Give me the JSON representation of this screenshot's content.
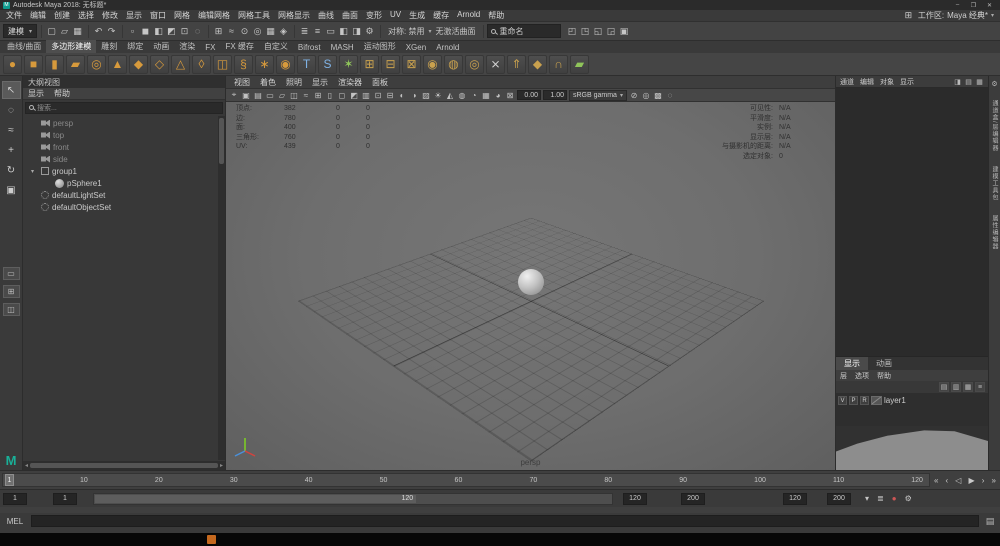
{
  "glyphs": {
    "app_initial": "M",
    "minimize": "–",
    "maximize": "❐",
    "close": "✕",
    "caret": "▾",
    "workspace_icon": "⊞",
    "script_editor_icon": "▤",
    "logo": "M"
  },
  "titlebar": {
    "title": "Autodesk Maya 2018: 无标题*"
  },
  "menubar": {
    "items": [
      "文件",
      "编辑",
      "创建",
      "选择",
      "修改",
      "显示",
      "窗口",
      "网格",
      "编辑网格",
      "网格工具",
      "网格显示",
      "曲线",
      "曲面",
      "变形",
      "UV",
      "生成",
      "缓存",
      "Arnold",
      "帮助"
    ],
    "workspace_label": "工作区:",
    "workspace_value": "Maya 经典*"
  },
  "statusline": {
    "menuset": "建模",
    "symmetry": "对称: 禁用",
    "live_surface": "无激活曲面",
    "name_field_text": "重命名",
    "file_ops": [
      {
        "g": "▢",
        "n": "new-scene-icon"
      },
      {
        "g": "▱",
        "n": "open-scene-icon"
      },
      {
        "g": "▦",
        "n": "save-scene-icon"
      }
    ],
    "undo_redo": [
      {
        "g": "↶",
        "n": "undo-icon"
      },
      {
        "g": "↷",
        "n": "redo-icon"
      }
    ],
    "selection": [
      {
        "g": "▫",
        "n": "select-hierarchy-icon"
      },
      {
        "g": "◼",
        "n": "select-object-icon"
      },
      {
        "g": "◧",
        "n": "select-component-icon"
      },
      {
        "g": "◩",
        "n": "selection-mask-icon"
      },
      {
        "g": "⊡",
        "n": "lock-selection-icon"
      },
      {
        "g": "◌",
        "n": "highlight-selection-icon"
      }
    ],
    "snapping": [
      {
        "g": "⊞",
        "n": "snap-to-grids-icon"
      },
      {
        "g": "≈",
        "n": "snap-to-curves-icon"
      },
      {
        "g": "⊙",
        "n": "snap-to-points-icon"
      },
      {
        "g": "◎",
        "n": "snap-to-projected-center-icon"
      },
      {
        "g": "▦",
        "n": "snap-to-view-planes-icon"
      },
      {
        "g": "◈",
        "n": "make-live-icon"
      }
    ],
    "history_render": [
      {
        "g": "≣",
        "n": "input-operations-icon"
      },
      {
        "g": "≡",
        "n": "construction-history-icon"
      },
      {
        "g": "▭",
        "n": "render-view-icon"
      },
      {
        "g": "◧",
        "n": "render-current-frame-icon"
      },
      {
        "g": "◨",
        "n": "ipr-render-icon"
      },
      {
        "g": "⚙",
        "n": "render-settings-icon"
      }
    ],
    "sidebar_toggles": [
      {
        "g": "◰",
        "n": "attribute-editor-toggle-icon"
      },
      {
        "g": "◳",
        "n": "tool-settings-toggle-icon"
      },
      {
        "g": "◱",
        "n": "channel-box-toggle-icon"
      },
      {
        "g": "◲",
        "n": "modeling-toolkit-toggle-icon"
      },
      {
        "g": "▣",
        "n": "humanik-toggle-ic icon"
      }
    ]
  },
  "shelf": {
    "tabs": [
      {
        "label": "曲线/曲面"
      },
      {
        "label": "多边形建模",
        "cls": "active"
      },
      {
        "label": "雕刻"
      },
      {
        "label": "绑定"
      },
      {
        "label": "动画"
      },
      {
        "label": "渲染"
      },
      {
        "label": "FX"
      },
      {
        "label": "FX 缓存"
      },
      {
        "label": "自定义"
      },
      {
        "label": "Bifrost"
      },
      {
        "label": "MASH"
      },
      {
        "label": "运动图形"
      },
      {
        "label": "XGen"
      },
      {
        "label": "Arnold"
      }
    ],
    "icons": [
      {
        "g": "●",
        "c": "#d79a3c",
        "n": "poly-sphere-icon"
      },
      {
        "g": "■",
        "c": "#d79a3c",
        "n": "poly-cube-icon"
      },
      {
        "g": "▮",
        "c": "#d79a3c",
        "n": "poly-cylinder-icon"
      },
      {
        "g": "▰",
        "c": "#d79a3c",
        "n": "poly-plane-icon"
      },
      {
        "g": "◎",
        "c": "#d79a3c",
        "n": "poly-torus-icon"
      },
      {
        "g": "▲",
        "c": "#d79a3c",
        "n": "poly-cone-icon"
      },
      {
        "g": "◆",
        "c": "#d79a3c",
        "n": "poly-disc-icon"
      },
      {
        "g": "◇",
        "c": "#d79a3c",
        "n": "poly-platonic-icon"
      },
      {
        "g": "△",
        "c": "#d79a3c",
        "n": "poly-pyramid-icon"
      },
      {
        "g": "◊",
        "c": "#d79a3c",
        "n": "poly-prism-icon"
      },
      {
        "g": "◫",
        "c": "#d79a3c",
        "n": "poly-pipe-icon"
      },
      {
        "g": "§",
        "c": "#d79a3c",
        "n": "poly-helix-icon"
      },
      {
        "g": "∗",
        "c": "#d79a3c",
        "n": "poly-gear-icon"
      },
      {
        "g": "◉",
        "c": "#d79a3c",
        "n": "poly-soccer-icon"
      },
      {
        "g": "T",
        "c": "#7fb2e5",
        "n": "poly-type-icon"
      },
      {
        "g": "S",
        "c": "#7fb2e5",
        "n": "svg-tool-icon"
      },
      {
        "g": "✶",
        "c": "#8fc45a",
        "n": "super-shape-icon"
      },
      {
        "g": "⊞",
        "c": "#c9a14e",
        "n": "combine-icon"
      },
      {
        "g": "⊟",
        "c": "#c9a14e",
        "n": "separate-icon"
      },
      {
        "g": "⊠",
        "c": "#c9a14e",
        "n": "extract-icon"
      },
      {
        "g": "◉",
        "c": "#c9a14e",
        "n": "boolean-icon"
      },
      {
        "g": "◍",
        "c": "#c9a14e",
        "n": "smooth-icon"
      },
      {
        "g": "◎",
        "c": "#c9a14e",
        "n": "reduce-icon"
      },
      {
        "g": "⨯",
        "c": "#d4d4d4",
        "n": "multi-cut-icon"
      },
      {
        "g": "⇑",
        "c": "#c9a14e",
        "n": "extrude-icon"
      },
      {
        "g": "◆",
        "c": "#c9a14e",
        "n": "bevel-icon"
      },
      {
        "g": "∩",
        "c": "#c9a14e",
        "n": "bridge-icon"
      },
      {
        "g": "▰",
        "c": "#8fc45a",
        "n": "quad-draw-icon"
      }
    ]
  },
  "toolbox": {
    "tools": [
      {
        "g": "↖",
        "n": "select-tool-icon",
        "cls": "active"
      },
      {
        "g": "◌",
        "n": "lasso-tool-icon"
      },
      {
        "g": "≈",
        "n": "paint-select-tool-icon"
      },
      {
        "g": "+",
        "n": "move-tool-icon"
      },
      {
        "g": "↻",
        "n": "rotate-tool-icon"
      },
      {
        "g": "▣",
        "n": "scale-tool-icon"
      }
    ],
    "layouts": [
      {
        "g": "▭",
        "n": "single-pane-layout-button"
      },
      {
        "g": "⊞",
        "n": "four-pane-layout-button"
      },
      {
        "g": "◫",
        "n": "two-pane-layout-button"
      }
    ]
  },
  "outliner": {
    "title": "大纲视图",
    "menus": [
      "显示",
      "帮助"
    ],
    "search_placeholder": "搜索...",
    "items": [
      {
        "label": "persp",
        "icon": "cam",
        "cls": "dim",
        "exp": ""
      },
      {
        "label": "top",
        "icon": "cam",
        "cls": "dim",
        "exp": ""
      },
      {
        "label": "front",
        "icon": "cam",
        "cls": "dim",
        "exp": ""
      },
      {
        "label": "side",
        "icon": "cam",
        "cls": "dim",
        "exp": ""
      },
      {
        "label": "group1",
        "icon": "grp",
        "exp": "▾"
      },
      {
        "label": "pSphere1",
        "icon": "sph",
        "cls": "child",
        "exp": ""
      },
      {
        "label": "defaultLightSet",
        "icon": "set",
        "exp": ""
      },
      {
        "label": "defaultObjectSet",
        "icon": "set",
        "exp": ""
      }
    ]
  },
  "viewport": {
    "menus": [
      "视图",
      "着色",
      "照明",
      "显示",
      "渲染器",
      "面板"
    ],
    "toolbar_icons": [
      {
        "g": "⌖",
        "n": "select-camera-icon"
      },
      {
        "g": "▣",
        "n": "lock-camera-icon"
      },
      {
        "g": "▤",
        "n": "camera-attributes-icon"
      },
      {
        "g": "▭",
        "n": "bookmarks-icon"
      },
      {
        "g": "▱",
        "n": "image-plane-icon"
      },
      {
        "g": "◫",
        "n": "2d-pan-zoom-icon"
      },
      {
        "g": "≈",
        "n": "grease-pencil-icon"
      },
      {
        "g": "⊞",
        "n": "grid-icon"
      },
      {
        "g": "▯",
        "n": "film-gate-icon"
      },
      {
        "g": "◻",
        "n": "resolution-gate-icon"
      },
      {
        "g": "◩",
        "n": "gate-mask-icon"
      },
      {
        "g": "▥",
        "n": "field-chart-icon"
      },
      {
        "g": "⊡",
        "n": "safe-action-icon"
      },
      {
        "g": "⊟",
        "n": "safe-title-icon"
      },
      {
        "g": "◐",
        "n": "wireframe-icon"
      },
      {
        "g": "◑",
        "n": "smooth-shade-icon"
      },
      {
        "g": "▨",
        "n": "textured-icon"
      },
      {
        "g": "☀",
        "n": "lighting-icon"
      },
      {
        "g": "◭",
        "n": "shadows-icon"
      },
      {
        "g": "◍",
        "n": "ssao-icon"
      },
      {
        "g": "◔",
        "n": "motion-blur-icon"
      },
      {
        "g": "▦",
        "n": "multisample-icon"
      },
      {
        "g": "◕",
        "n": "depth-of-field-icon"
      },
      {
        "g": "⊠",
        "n": "isolate-select-icon"
      }
    ],
    "exposure": "0.00",
    "gamma": "1.00",
    "view_transform": "sRGB gamma",
    "toolbar_icons_right": [
      {
        "g": "⊘",
        "n": "xray-icon"
      },
      {
        "g": "◎",
        "n": "exposure-toggle-icon"
      },
      {
        "g": "▩",
        "n": "gamma-toggle-icon"
      },
      {
        "g": "◌",
        "n": "view-transform-icon"
      }
    ],
    "hud_left": [
      [
        "顶点:",
        "382",
        "0",
        "0"
      ],
      [
        "边:",
        "780",
        "0",
        "0"
      ],
      [
        "面:",
        "400",
        "0",
        "0"
      ],
      [
        "三角形:",
        "760",
        "0",
        "0"
      ],
      [
        "UV:",
        "439",
        "0",
        "0"
      ]
    ],
    "hud_right": [
      [
        "可见性:",
        "N/A"
      ],
      [
        "平滑度:",
        "N/A"
      ],
      [
        "实例:",
        "N/A"
      ],
      [
        "显示层:",
        "N/A"
      ],
      [
        "与摄影机的距离:",
        "N/A"
      ],
      [
        "选定对象:",
        "0"
      ]
    ],
    "camera_label": "persp"
  },
  "channel_box": {
    "menus": [
      "通道",
      "编辑",
      "对象",
      "显示"
    ],
    "corner_icons": [
      {
        "g": "◨",
        "n": "channel-manip-icon"
      },
      {
        "g": "▤",
        "n": "channel-speed-icon"
      },
      {
        "g": "▦",
        "n": "channel-settings-icon"
      }
    ]
  },
  "layer_editor": {
    "tabs": [
      {
        "label": "显示",
        "cls": "active"
      },
      {
        "label": "动画"
      }
    ],
    "menus": [
      "层",
      "选项",
      "帮助"
    ],
    "toolbar_icons": [
      {
        "g": "▤",
        "n": "move-layer-up-icon"
      },
      {
        "g": "▥",
        "n": "new-empty-layer-icon"
      },
      {
        "g": "▦",
        "n": "new-layer-from-selected-icon"
      },
      {
        "g": "≡",
        "n": "layer-options-icon"
      }
    ],
    "layer": {
      "toggles": [
        "V",
        "P",
        "R"
      ],
      "name": "layer1"
    }
  },
  "side_tabs": [
    "通道盒/层编辑器",
    "建模工具包",
    "属性编辑器"
  ],
  "time_slider": {
    "ticks": [
      "1",
      "10",
      "20",
      "30",
      "40",
      "50",
      "60",
      "70",
      "80",
      "90",
      "100",
      "110",
      "120"
    ],
    "current_frame": "1",
    "transport": [
      {
        "g": "«",
        "n": "go-to-start-button"
      },
      {
        "g": "‹",
        "n": "step-back-button"
      },
      {
        "g": "◁",
        "n": "play-backwards-button"
      },
      {
        "g": "▶",
        "n": "play-forwards-button"
      },
      {
        "g": "›",
        "n": "step-forward-button"
      },
      {
        "g": "»",
        "n": "go-to-end-button"
      }
    ]
  },
  "range_slider": {
    "animation_start": "1",
    "playback_start": "1",
    "range_label": "120",
    "playback_end": "120",
    "animation_end": "200",
    "alt_playback_end": "120",
    "alt_animation_end": "200",
    "icons": [
      {
        "g": "▾",
        "n": "character-set-menu-icon"
      },
      {
        "g": "≣",
        "n": "anim-layer-menu-icon"
      },
      {
        "g": "●",
        "n": "auto-keyframe-icon",
        "cls": "autokey"
      },
      {
        "g": "⚙",
        "n": "animation-preferences-icon"
      }
    ]
  },
  "command_line": {
    "label": "MEL",
    "value": ""
  }
}
